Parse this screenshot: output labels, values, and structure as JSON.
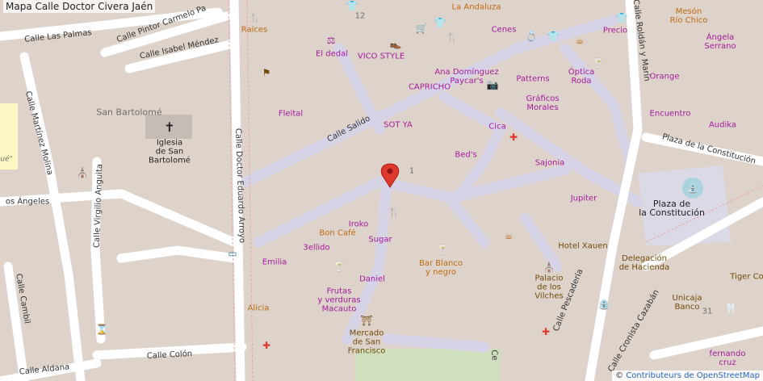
{
  "title": "Mapa Calle Doctor Civera Jaén",
  "attribution": {
    "prefix": "© ",
    "link": "Contributeurs de OpenStreetMap"
  },
  "streets": {
    "las_palmas": "Calle Las Palmas",
    "pintor_carmelo": "Calle Pintor Carmelo Pa",
    "isabel_mendez": "Calle Isabel Méndez",
    "martinez_molina": "Calle Martínez Molina",
    "virgilio_anguita": "Calle Virgilio Anguita",
    "angeles": "os Ángeles",
    "cambil": "Calle Cambil",
    "colon": "Calle Colón",
    "aldana": "Calle Aldana",
    "doctor_eduardo_arroyo": "Calle Doctor Eduardo Arroyo",
    "salido": "Calle Salido",
    "pescaderia": "Calle Pescadería",
    "cronista_cazaban": "Calle Cronista Cazabán",
    "roldan_marin": "Calle Roldán y Marín",
    "plaza_constitucion_street": "Plaza de la Constitución",
    "ce_short": "Ce"
  },
  "places": {
    "san_bartolome": "San Bartolomé",
    "iglesia": "Iglesia\nde San\nBartolomé",
    "plaza_constitucion": "Plaza de\nla Constitución",
    "number_12": "12",
    "number_1": "1",
    "number_31": "31",
    "ue_fragment": "ué\""
  },
  "pois": {
    "raices": "Raíces",
    "la_andaluza": "La Andaluza",
    "cenes": "Cenes",
    "precio": "Precio",
    "meson_rio_chico": "Mesón\nRío Chico",
    "angela_serrano": "Ángela\nSerrano",
    "el_dedal": "El dedal",
    "vico_style": "VICO STYLE",
    "ana_dominguez": "Ana Domínguez\nPaycar's",
    "capricho": "CAPRICHO",
    "patterns": "Patterns",
    "optica_roda": "Óptica\nRoda",
    "orange": "Orange",
    "audika": "Audika",
    "encuentro": "Encuentro",
    "fleital": "Fleital",
    "sot_ya": "SOT YA",
    "graficos_morales": "Gráficos\nMorales",
    "cica": "Cica",
    "beds": "Bed's",
    "sajonia": "Sajonia",
    "jupiter": "Jupiter",
    "iroko": "Iroko",
    "bon_cafe": "Bon Café",
    "sugar": "Sugar",
    "emilia": "Emilia",
    "3ellido": "3ellido",
    "hotel_xauen": "Hotel Xauen",
    "bar_blanco": "Bar Blanco\ny negro",
    "daniel": "Daniel",
    "delegacion": "Delegación\nde Hacienda",
    "alicia": "Alicia",
    "frutas": "Frutas\ny verduras\nMacauto",
    "palacio": "Palacio\nde los\nVilches",
    "unicaja": "Unicaja\nBanco",
    "tiger": "Tiger Co",
    "mercado": "Mercado\nde San\nFrancisco",
    "fernando": "fernando\ncruz"
  },
  "colors": {
    "background": "#ddd3cb",
    "pedestrian": "#dbd9e5",
    "road": "#ffffff",
    "building": "#d0c7bf",
    "shop": "#a61a9e",
    "food": "#c06a11",
    "marker": "#e0382c",
    "school": "#fdf7c3",
    "water": "#aad3df"
  }
}
